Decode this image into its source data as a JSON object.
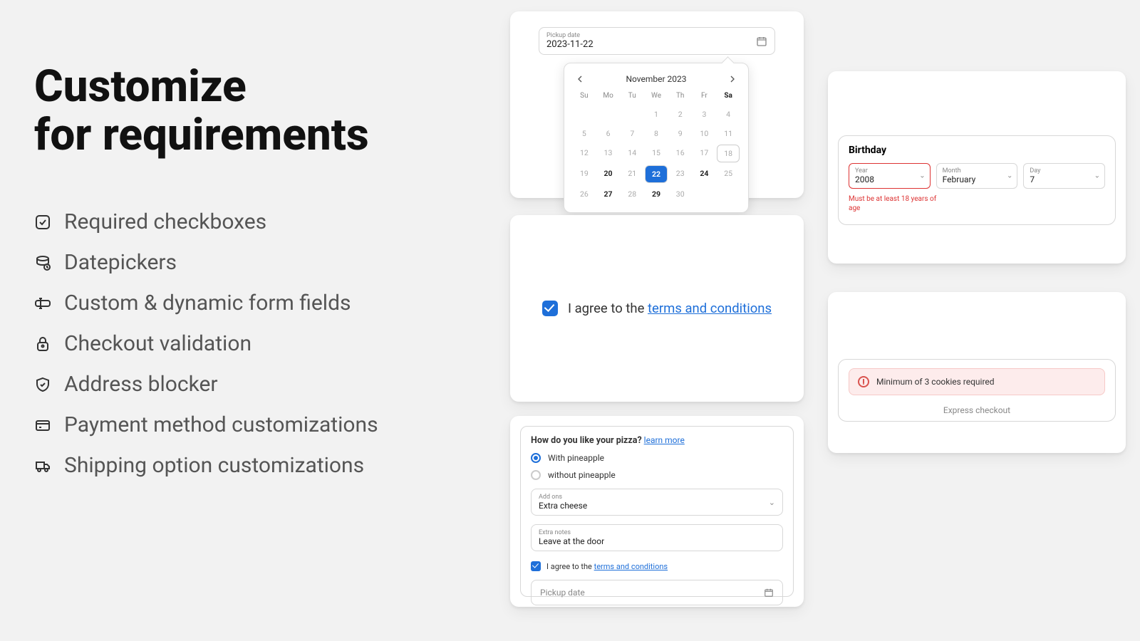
{
  "heading_line1": "Customize",
  "heading_line2": "for requirements",
  "features": [
    "Required checkboxes",
    "Datepickers",
    "Custom & dynamic form fields",
    "Checkout validation",
    "Address blocker",
    "Payment method customizations",
    "Shipping option customizations"
  ],
  "datepicker": {
    "label": "Pickup date",
    "value": "2023-11-22",
    "month_label": "November 2023",
    "dows": [
      "Su",
      "Mo",
      "Tu",
      "We",
      "Th",
      "Fr",
      "Sa"
    ],
    "cells": [
      {
        "d": "",
        "c": ""
      },
      {
        "d": "",
        "c": ""
      },
      {
        "d": "",
        "c": ""
      },
      {
        "d": "1",
        "c": ""
      },
      {
        "d": "2",
        "c": ""
      },
      {
        "d": "3",
        "c": ""
      },
      {
        "d": "4",
        "c": ""
      },
      {
        "d": "5",
        "c": ""
      },
      {
        "d": "6",
        "c": ""
      },
      {
        "d": "7",
        "c": ""
      },
      {
        "d": "8",
        "c": ""
      },
      {
        "d": "9",
        "c": ""
      },
      {
        "d": "10",
        "c": ""
      },
      {
        "d": "11",
        "c": ""
      },
      {
        "d": "12",
        "c": ""
      },
      {
        "d": "13",
        "c": ""
      },
      {
        "d": "14",
        "c": ""
      },
      {
        "d": "15",
        "c": ""
      },
      {
        "d": "16",
        "c": ""
      },
      {
        "d": "17",
        "c": ""
      },
      {
        "d": "18",
        "c": "today"
      },
      {
        "d": "19",
        "c": ""
      },
      {
        "d": "20",
        "c": "bold"
      },
      {
        "d": "21",
        "c": ""
      },
      {
        "d": "22",
        "c": "sel"
      },
      {
        "d": "23",
        "c": ""
      },
      {
        "d": "24",
        "c": "bold"
      },
      {
        "d": "25",
        "c": ""
      },
      {
        "d": "26",
        "c": ""
      },
      {
        "d": "27",
        "c": "bold"
      },
      {
        "d": "28",
        "c": ""
      },
      {
        "d": "29",
        "c": "bold"
      },
      {
        "d": "30",
        "c": ""
      },
      {
        "d": "",
        "c": ""
      },
      {
        "d": "",
        "c": ""
      }
    ]
  },
  "tc": {
    "prefix": "I agree to the",
    "link": "terms and conditions"
  },
  "pizza": {
    "question": "How do you like your pizza?",
    "learn": "learn more",
    "opt1": "With pineapple",
    "opt2": "without pineapple",
    "addons_label": "Add ons",
    "addons_value": "Extra cheese",
    "notes_label": "Extra notes",
    "notes_value": "Leave at the door",
    "tc_prefix": "I agree to the",
    "tc_link": "terms and conditions",
    "pickup_label": "Pickup date"
  },
  "birthday": {
    "title": "Birthday",
    "year_label": "Year",
    "year_value": "2008",
    "month_label": "Month",
    "month_value": "February",
    "day_label": "Day",
    "day_value": "7",
    "error": "Must be at least 18 years of age"
  },
  "express": {
    "alert": "Minimum of 3 cookies required",
    "footer": "Express checkout"
  }
}
